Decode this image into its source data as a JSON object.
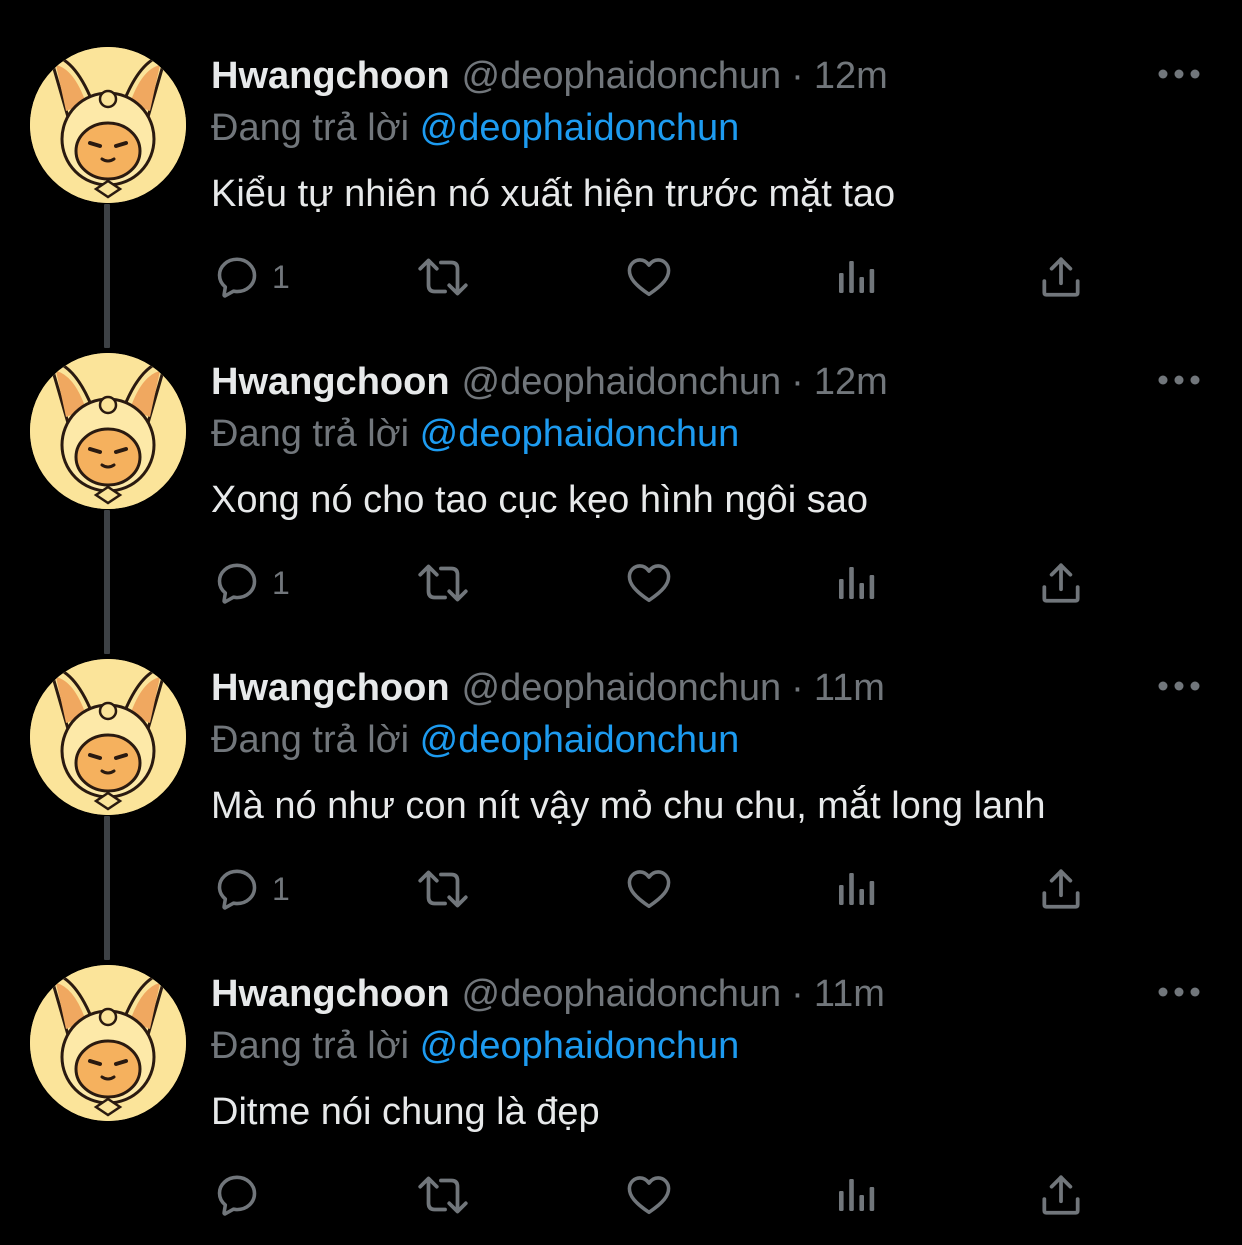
{
  "colors": {
    "background": "#000000",
    "text_primary": "#e7e9ea",
    "text_secondary": "#71767b",
    "link": "#1d9bf0",
    "thread_line": "#3d4145",
    "avatar_bg": "#fbe49a"
  },
  "icons": {
    "reply": "speech-bubble-icon",
    "retweet": "retweet-icon",
    "like": "heart-icon",
    "views": "bar-chart-icon",
    "share": "share-upload-icon",
    "more": "ellipsis-icon"
  },
  "tweets": [
    {
      "name": "Hwangchoon",
      "handle": "@deophaidonchun",
      "dot": "·",
      "time": "12m",
      "replying_prefix": "Đang trả lời",
      "replying_to": "@deophaidonchun",
      "text": "Kiểu tự nhiên nó xuất hiện trước mặt tao",
      "reply_count": "1"
    },
    {
      "name": "Hwangchoon",
      "handle": "@deophaidonchun",
      "dot": "·",
      "time": "12m",
      "replying_prefix": "Đang trả lời",
      "replying_to": "@deophaidonchun",
      "text": "Xong nó cho tao cục kẹo hình ngôi sao",
      "reply_count": "1"
    },
    {
      "name": "Hwangchoon",
      "handle": "@deophaidonchun",
      "dot": "·",
      "time": "11m",
      "replying_prefix": "Đang trả lời",
      "replying_to": "@deophaidonchun",
      "text": "Mà nó như con nít vậy mỏ chu chu, mắt long lanh",
      "reply_count": "1"
    },
    {
      "name": "Hwangchoon",
      "handle": "@deophaidonchun",
      "dot": "·",
      "time": "11m",
      "replying_prefix": "Đang trả lời",
      "replying_to": "@deophaidonchun",
      "text": "Ditme nói chung là đẹp",
      "reply_count": ""
    }
  ]
}
